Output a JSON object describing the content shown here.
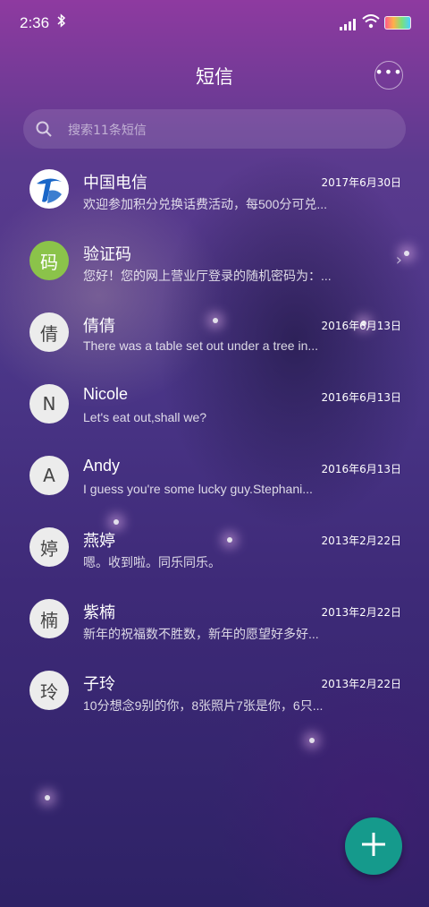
{
  "status_bar": {
    "time": "2:36"
  },
  "header": {
    "title": "短信"
  },
  "search": {
    "placeholder": "搜索11条短信"
  },
  "messages": [
    {
      "avatar": "",
      "sender": "中国电信",
      "date": "2017年6月30日",
      "preview": "欢迎参加积分兑换话费活动，每500分可兑..."
    },
    {
      "avatar": "码",
      "sender": "验证码",
      "date": "",
      "preview": "您好！您的网上营业厅登录的随机密码为：..."
    },
    {
      "avatar": "倩",
      "sender": "倩倩",
      "date": "2016年6月13日",
      "preview": "There was a table set out under a tree in..."
    },
    {
      "avatar": "N",
      "sender": "Nicole",
      "date": "2016年6月13日",
      "preview": "Let's eat out,shall we?"
    },
    {
      "avatar": "A",
      "sender": "Andy",
      "date": "2016年6月13日",
      "preview": "I guess you're some lucky guy.Stephani..."
    },
    {
      "avatar": "婷",
      "sender": "燕婷",
      "date": "2013年2月22日",
      "preview": "嗯。收到啦。同乐同乐。"
    },
    {
      "avatar": "楠",
      "sender": "紫楠",
      "date": "2013年2月22日",
      "preview": "新年的祝福数不胜数，新年的愿望好多好..."
    },
    {
      "avatar": "玲",
      "sender": "子玲",
      "date": "2013年2月22日",
      "preview": "10分想念9别的你，8张照片7张是你，6只..."
    }
  ],
  "colors": {
    "fab": "#159a8c",
    "verify_avatar": "#8bc34a",
    "telecom_blue": "#1a67c8"
  }
}
